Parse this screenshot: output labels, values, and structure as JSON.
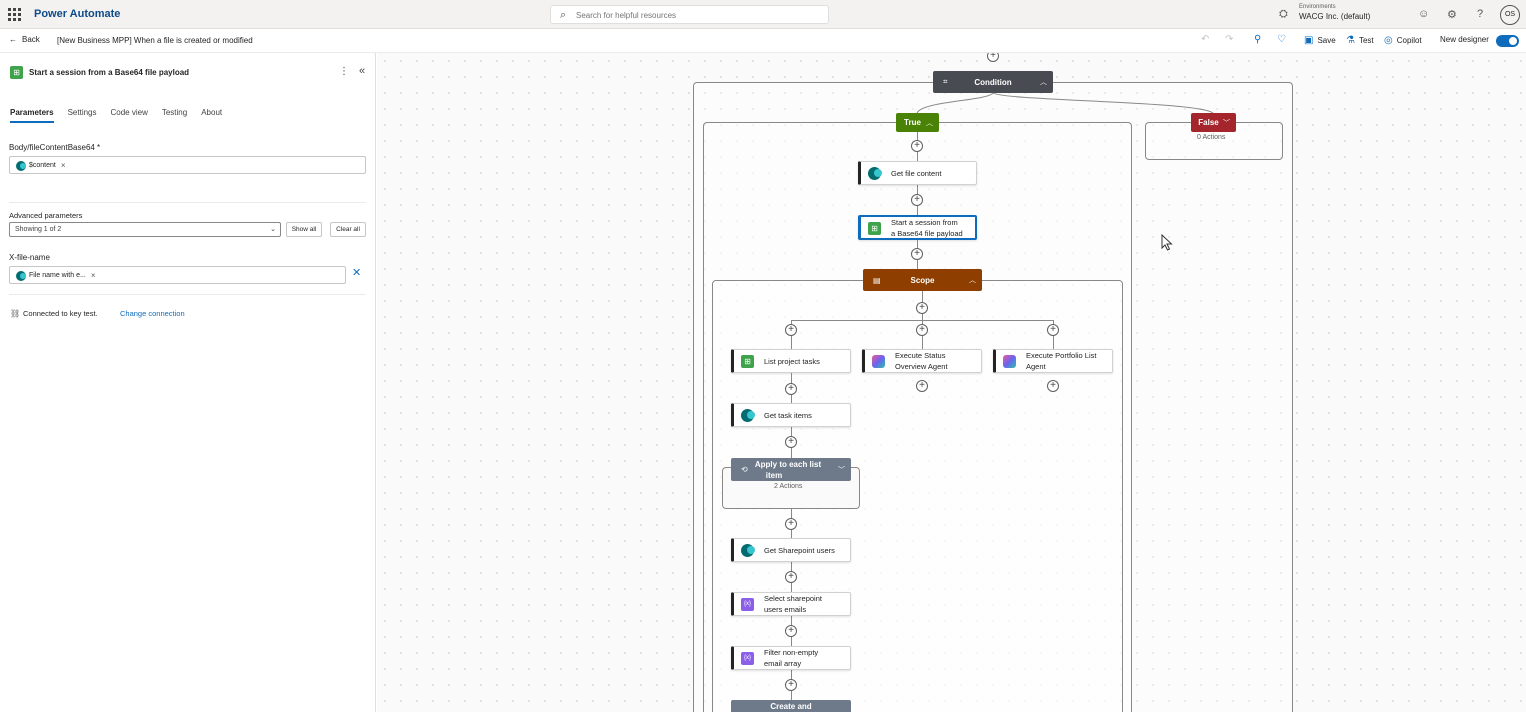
{
  "topbar": {
    "app_name": "Power Automate",
    "search_placeholder": "Search for helpful resources",
    "env_label": "Environments",
    "env_name": "WACG Inc. (default)",
    "avatar": "OS"
  },
  "cmdbar": {
    "back": "Back",
    "flow_title": "[New Business MPP] When a file is created or modified",
    "save": "Save",
    "test": "Test",
    "copilot": "Copilot",
    "new_designer": "New designer",
    "new_designer_on": true
  },
  "panel": {
    "title": "Start a session from a Base64 file payload",
    "tabs": [
      "Parameters",
      "Settings",
      "Code view",
      "Testing",
      "About"
    ],
    "active_tab": "Parameters",
    "body_label": "Body/fileContentBase64 *",
    "body_token": "$content",
    "advanced_label": "Advanced parameters",
    "advanced_value": "Showing 1 of 2",
    "show_all": "Show all",
    "clear_all": "Clear all",
    "xfile_label": "X-file-name",
    "xfile_token": "File name with e...",
    "connection_text": "Connected to key test.",
    "change_connection": "Change connection"
  },
  "canvas": {
    "condition": "Condition",
    "true_label": "True",
    "false_label": "False",
    "false_actions": "0 Actions",
    "get_file_content": "Get file content",
    "start_session_line1": "Start a session from",
    "start_session_line2": "a Base64 file payload",
    "scope": "Scope",
    "list_project_tasks": "List project tasks",
    "exec_status_line1": "Execute Status",
    "exec_status_line2": "Overview Agent",
    "exec_portfolio_line1": "Execute Portfolio List",
    "exec_portfolio_line2": "Agent",
    "get_task_items": "Get task items",
    "apply_each_line1": "Apply to each list",
    "apply_each_line2": "item",
    "apply_each_actions": "2 Actions",
    "get_sp_users": "Get Sharepoint users",
    "select_emails_line1": "Select sharepoint",
    "select_emails_line2": "users emails",
    "filter_line1": "Filter non-empty",
    "filter_line2": "email array",
    "create_and": "Create and"
  },
  "colors": {
    "accent": "#0f6cbd",
    "condition": "#484b52",
    "true": "#498205",
    "false": "#a4262c",
    "scope": "#8e3f00",
    "loop": "#6e7a8a"
  },
  "icons": {
    "sharepoint": "sharepoint-icon",
    "excel_green": "table-icon",
    "data_op": "data-operation-icon",
    "agent": "copilot-agent-icon"
  }
}
